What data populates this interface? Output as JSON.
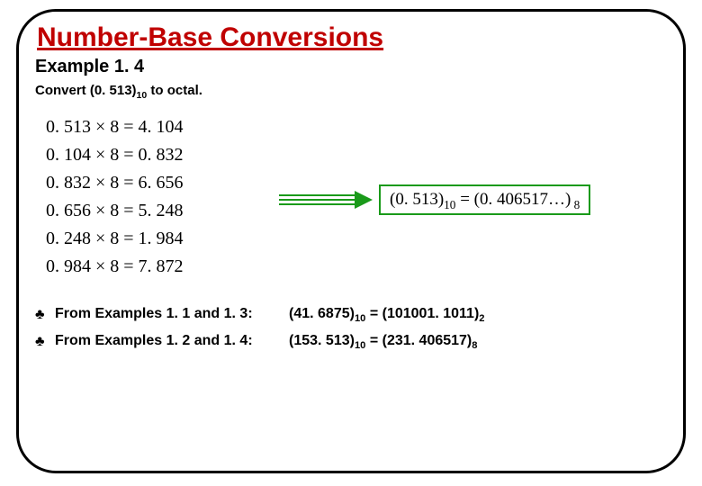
{
  "title": "Number-Base Conversions",
  "example_label": "Example 1. 4",
  "prompt_prefix": "Convert (0. 513)",
  "prompt_sub": "10",
  "prompt_suffix": " to octal.",
  "calc_lines": [
    "0. 513 × 8 = 4. 104",
    "0. 104 × 8 = 0. 832",
    "0. 832 × 8 = 6. 656",
    "0. 656 × 8 = 5. 248",
    "0. 248 × 8 = 1. 984",
    "0. 984 × 8 = 7. 872"
  ],
  "result_lhs_main": "(0. 513)",
  "result_lhs_sub": "10",
  "result_eq": "   =  ",
  "result_rhs_main": "(0. 406517…)",
  "result_rhs_sub": " 8",
  "notes": [
    {
      "label": "From Examples 1. 1 and 1. 3:",
      "value_a_main": "(41. 6875)",
      "value_a_sub": "10",
      "value_eq": " = ",
      "value_b_main": "(101001. 1011)",
      "value_b_sub": "2"
    },
    {
      "label": "From Examples 1. 2 and 1. 4:",
      "value_a_main": "(153. 513)",
      "value_a_sub": "10",
      "value_eq": " = ",
      "value_b_main": "(231. 406517)",
      "value_b_sub": "8"
    }
  ],
  "club_glyph": "♣"
}
